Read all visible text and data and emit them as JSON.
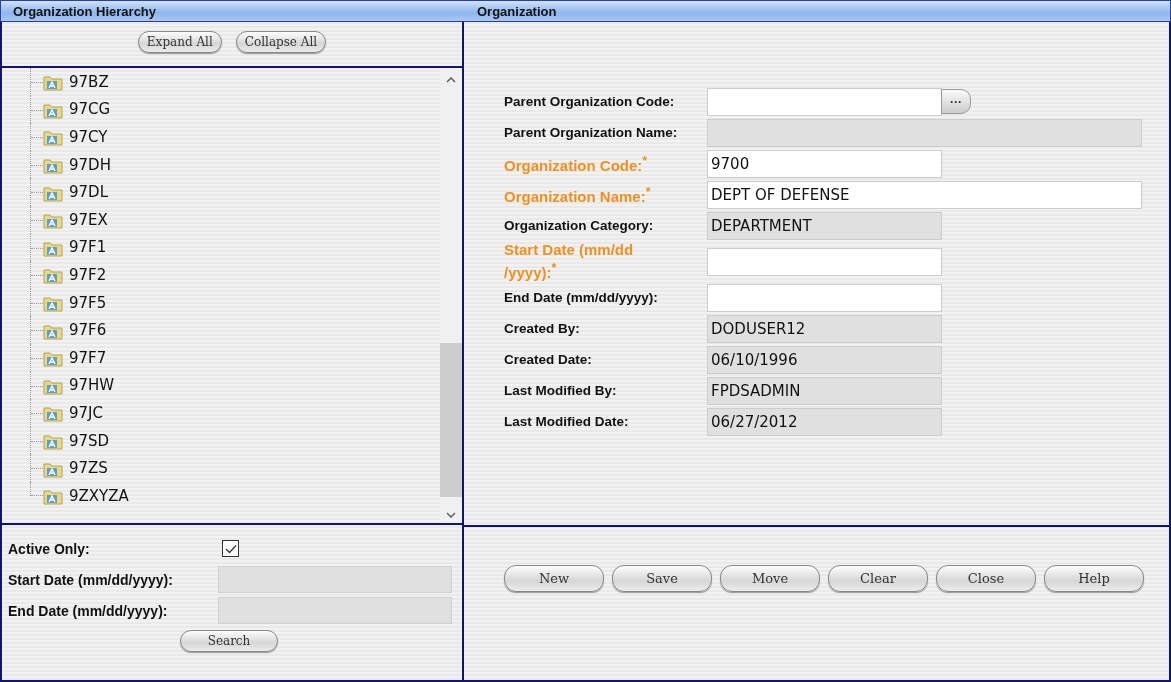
{
  "headers": {
    "left": "Organization Hierarchy",
    "right": "Organization"
  },
  "tree_buttons": [
    "Expand All",
    "Collapse All"
  ],
  "tree": {
    "items": [
      {
        "label": "97BZ"
      },
      {
        "label": "97CG"
      },
      {
        "label": "97CY"
      },
      {
        "label": "97DH"
      },
      {
        "label": "97DL"
      },
      {
        "label": "97EX"
      },
      {
        "label": "97F1"
      },
      {
        "label": "97F2"
      },
      {
        "label": "97F5"
      },
      {
        "label": "97F6"
      },
      {
        "label": "97F7"
      },
      {
        "label": "97HW"
      },
      {
        "label": "97JC"
      },
      {
        "label": "97SD"
      },
      {
        "label": "97ZS"
      },
      {
        "label": "9ZXYZA"
      }
    ]
  },
  "filter": {
    "active_only": {
      "label": "Active Only:",
      "checked": true
    },
    "fields": [
      {
        "label": "Start Date (mm/dd/yyyy):"
      },
      {
        "label": "End Date (mm/dd/yyyy):"
      }
    ],
    "search_button": "Search"
  },
  "form": {
    "fields": [
      {
        "label": "Parent Organization Code:",
        "required": false,
        "kind": "lookup",
        "wide": false,
        "lookup_button": "···"
      },
      {
        "label": "Parent Organization Name:",
        "required": false,
        "kind": "readonly",
        "wide": true
      },
      {
        "label": "Organization Code:$^{*}$",
        "required": true,
        "kind": "input",
        "value": "9700",
        "wide": false
      },
      {
        "label": "Organization Name:$^{*}$",
        "required": true,
        "kind": "input",
        "value": "DEPT OF DEFENSE",
        "wide": true
      },
      {
        "label": "Organization Category:",
        "required": false,
        "kind": "readonly",
        "value": "DEPARTMENT",
        "wide": false
      },
      {
        "label": "Start Date (mm/dd /yyyy):$^{*}$",
        "required": true,
        "kind": "input",
        "wide": false
      },
      {
        "label": "End Date (mm/dd/yyyy):",
        "required": false,
        "kind": "input",
        "wide": false
      },
      {
        "label": "Created By:",
        "required": false,
        "kind": "readonly",
        "value": "DODUSER12",
        "wide": false
      },
      {
        "label": "Created Date:",
        "required": false,
        "kind": "readonly",
        "value": "06/10/1996",
        "wide": false
      },
      {
        "label": "Last Modified By:",
        "required": false,
        "kind": "readonly",
        "value": "FPDSADMIN",
        "wide": false
      },
      {
        "label": "Last Modified Date:",
        "required": false,
        "kind": "readonly",
        "value": "06/27/2012",
        "wide": false
      }
    ]
  },
  "actions": [
    "New",
    "Save",
    "Move",
    "Clear",
    "Close",
    "Help"
  ]
}
